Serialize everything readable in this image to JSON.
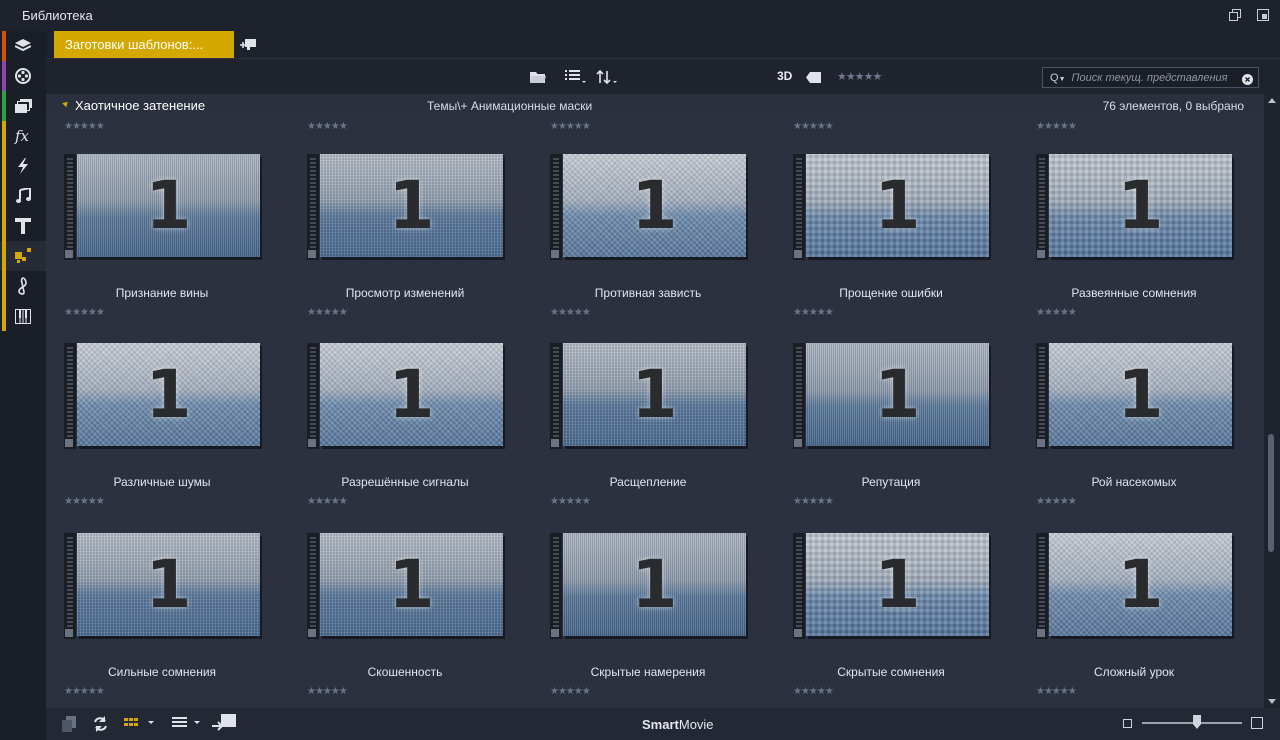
{
  "window": {
    "title": "Библиотека"
  },
  "tabs": {
    "active_label": "Заготовки шаблонов:..."
  },
  "toolbar": {
    "mode_3d": "3D",
    "rating_filter": "★★★★★",
    "search": {
      "prefix": "Q",
      "placeholder": "Поиск текущ. представления"
    }
  },
  "group": {
    "name": "Хаотичное затенение",
    "path": "Темы\\+ Анимационные маски",
    "count": "76 элементов, 0 выбрано"
  },
  "rating_glyphs": "★★★★★",
  "thumbnail_number": "1",
  "items": [
    {
      "label": "Признание вины",
      "rating": 0
    },
    {
      "label": "Просмотр изменений",
      "rating": 0
    },
    {
      "label": "Противная зависть",
      "rating": 0
    },
    {
      "label": "Прощение ошибки",
      "rating": 0
    },
    {
      "label": "Развеянные сомнения",
      "rating": 0
    },
    {
      "label": "Различные шумы",
      "rating": 0
    },
    {
      "label": "Разрешённые сигналы",
      "rating": 0
    },
    {
      "label": "Расщепление",
      "rating": 0
    },
    {
      "label": "Репутация",
      "rating": 0
    },
    {
      "label": "Рой насекомых",
      "rating": 0
    },
    {
      "label": "Сильные сомнения",
      "rating": 0
    },
    {
      "label": "Скошенность",
      "rating": 0
    },
    {
      "label": "Скрытые намерения",
      "rating": 0
    },
    {
      "label": "Скрытые сомнения",
      "rating": 0
    },
    {
      "label": "Сложный урок",
      "rating": 0
    }
  ],
  "bottom": {
    "smart_bold": "Smart",
    "smart_rest": "Movie",
    "zoom_level": 0.55
  },
  "rail_icons": [
    "project-bin-icon",
    "film-reel-icon",
    "collections-icon",
    "effects-fx-icon",
    "transitions-lightning-icon",
    "music-note-icon",
    "title-t-icon",
    "templates-icon",
    "sound-effects-icon",
    "piano-icon"
  ],
  "rail_colors": [
    "#d35400",
    "#8e44ad",
    "#2e9e3e",
    "#d5a800",
    "#d5a800",
    "#d5a800",
    "#d5a800",
    "#d5a800",
    "#d5a800",
    "#d5a800"
  ],
  "colors": {
    "accent": "#d5a800",
    "background": "#2c3140"
  }
}
